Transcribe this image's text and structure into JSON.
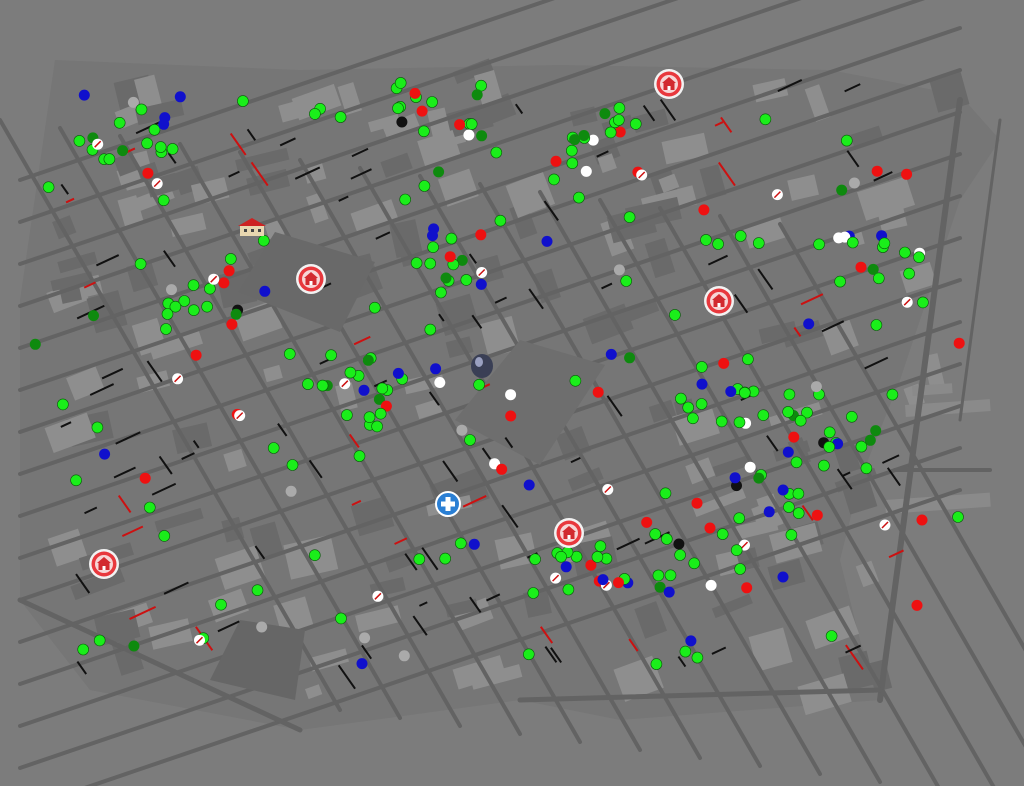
{
  "scene": {
    "background": "#7c7c7c",
    "road_color": "#626262",
    "block_dark": "#6a6a6a",
    "block_light": "#8e8e8e"
  },
  "legend_colors": {
    "green": "#1aee1a",
    "dark_green": "#0e8a0e",
    "red": "#ee1111",
    "blue": "#1010cc",
    "white": "#ffffff",
    "black": "#111111",
    "gray": "#aaaaaa"
  },
  "icons": {
    "shelter_marker": "house-badge-icon",
    "hospital_marker": "plus-badge-icon",
    "dome_marker": "dome-icon",
    "building_marker": "red-roof-building-icon"
  }
}
